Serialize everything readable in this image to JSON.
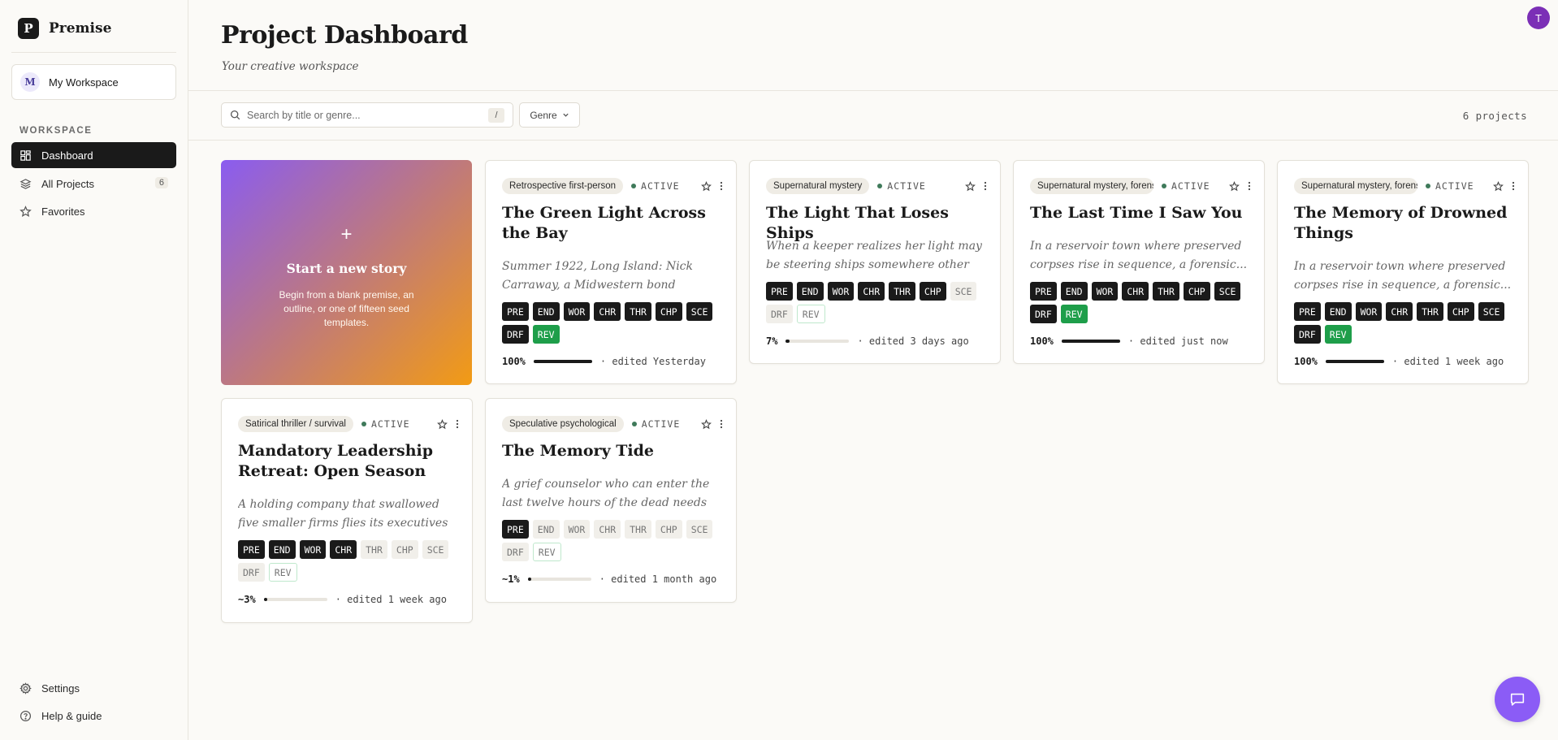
{
  "brand": {
    "logo_letter": "P",
    "name": "Premise"
  },
  "workspace": {
    "avatar": "M",
    "name": "My Workspace"
  },
  "sidebar": {
    "section": "WORKSPACE",
    "items": [
      {
        "label": "Dashboard",
        "icon": "dashboard-icon",
        "active": true
      },
      {
        "label": "All Projects",
        "icon": "layers-icon",
        "count": "6"
      },
      {
        "label": "Favorites",
        "icon": "star-icon"
      }
    ],
    "bottom": [
      {
        "label": "Settings",
        "icon": "gear-icon"
      },
      {
        "label": "Help & guide",
        "icon": "help-icon"
      }
    ]
  },
  "header": {
    "title": "Project Dashboard",
    "subtitle": "Your creative workspace",
    "user_avatar": "T"
  },
  "toolbar": {
    "search_placeholder": "Search by title or genre...",
    "search_shortcut": "/",
    "genre_label": "Genre",
    "project_count": "6 projects"
  },
  "new_story": {
    "plus": "+",
    "title": "Start a new story",
    "description": "Begin from a blank premise, an outline, or one of fifteen seed templates."
  },
  "projects": [
    {
      "genre": "Retrospective first-person",
      "status": "ACTIVE",
      "title": "The Green Light Across the Bay",
      "description": "Summer 1922, Long Island: Nick Carraway, a Midwestern bond salesman...",
      "stages": [
        "PRE",
        "END",
        "WOR",
        "CHR",
        "THR",
        "CHP",
        "SCE",
        "DRF",
        "REV"
      ],
      "stages_done": 9,
      "progress_label": "100%",
      "progress": 1.0,
      "edited": "edited Yesterday"
    },
    {
      "genre": "Supernatural mystery",
      "status": "ACTIVE",
      "title": "The Light That Loses Ships",
      "description": "When a keeper realizes her light may be steering ships somewhere other than...",
      "stages": [
        "PRE",
        "END",
        "WOR",
        "CHR",
        "THR",
        "CHP",
        "SCE",
        "DRF",
        "REV"
      ],
      "stages_done": 6,
      "progress_label": "7%",
      "progress": 0.07,
      "edited": "edited 3 days ago"
    },
    {
      "genre": "Supernatural mystery, forensic",
      "status": "ACTIVE",
      "title": "The Last Time I Saw You",
      "description": "In a reservoir town where preserved corpses rise in sequence, a forensic...",
      "stages": [
        "PRE",
        "END",
        "WOR",
        "CHR",
        "THR",
        "CHP",
        "SCE",
        "DRF",
        "REV"
      ],
      "stages_done": 9,
      "progress_label": "100%",
      "progress": 1.0,
      "edited": "edited just now"
    },
    {
      "genre": "Supernatural mystery, forensic",
      "status": "ACTIVE",
      "title": "The Memory of Drowned Things",
      "description": "In a reservoir town where preserved corpses rise in sequence, a forensic...",
      "stages": [
        "PRE",
        "END",
        "WOR",
        "CHR",
        "THR",
        "CHP",
        "SCE",
        "DRF",
        "REV"
      ],
      "stages_done": 9,
      "progress_label": "100%",
      "progress": 1.0,
      "edited": "edited 1 week ago"
    },
    {
      "genre": "Satirical thriller / survival",
      "status": "ACTIVE",
      "title": "Mandatory Leadership Retreat: Open Season",
      "description": "A holding company that swallowed five smaller firms flies its executives and...",
      "stages": [
        "PRE",
        "END",
        "WOR",
        "CHR",
        "THR",
        "CHP",
        "SCE",
        "DRF",
        "REV"
      ],
      "stages_done": 4,
      "progress_label": "~3%",
      "progress": 0.03,
      "edited": "edited 1 week ago"
    },
    {
      "genre": "Speculative psychological",
      "status": "ACTIVE",
      "title": "The Memory Tide",
      "description": "A grief counselor who can enter the last twelve hours of the dead needs to solve...",
      "stages": [
        "PRE",
        "END",
        "WOR",
        "CHR",
        "THR",
        "CHP",
        "SCE",
        "DRF",
        "REV"
      ],
      "stages_done": 1,
      "progress_label": "~1%",
      "progress": 0.01,
      "edited": "edited 1 month ago"
    }
  ]
}
